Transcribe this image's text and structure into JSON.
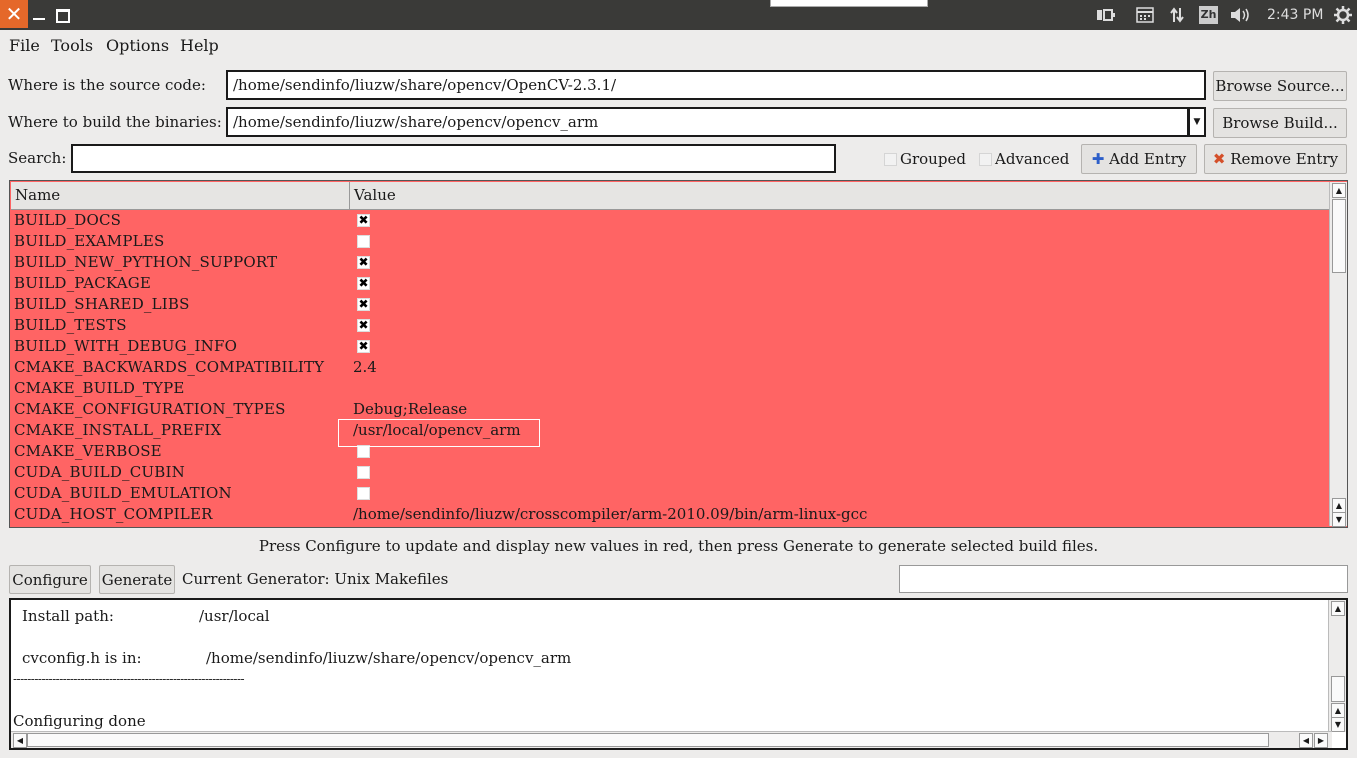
{
  "taskbar": {
    "close_glyph": "✕",
    "time": "2:43 PM",
    "ime": "Zh"
  },
  "menu": [
    "File",
    "Tools",
    "Options",
    "Help"
  ],
  "source": {
    "label": "Where is the source code:",
    "value": "/home/sendinfo/liuzw/share/opencv/OpenCV-2.3.1/",
    "button": "Browse Source..."
  },
  "build": {
    "label": "Where to build the binaries:",
    "value": "/home/sendinfo/liuzw/share/opencv/opencv_arm",
    "button": "Browse Build..."
  },
  "search": {
    "label": "Search:",
    "value": ""
  },
  "options": {
    "grouped": "Grouped",
    "advanced": "Advanced",
    "add_entry": "Add Entry",
    "remove_entry": "Remove Entry"
  },
  "table": {
    "headers": [
      "Name",
      "Value"
    ],
    "rows": [
      {
        "name": "BUILD_DOCS",
        "type": "bool",
        "checked": true
      },
      {
        "name": "BUILD_EXAMPLES",
        "type": "bool",
        "checked": false
      },
      {
        "name": "BUILD_NEW_PYTHON_SUPPORT",
        "type": "bool",
        "checked": true
      },
      {
        "name": "BUILD_PACKAGE",
        "type": "bool",
        "checked": true
      },
      {
        "name": "BUILD_SHARED_LIBS",
        "type": "bool",
        "checked": true
      },
      {
        "name": "BUILD_TESTS",
        "type": "bool",
        "checked": true
      },
      {
        "name": "BUILD_WITH_DEBUG_INFO",
        "type": "bool",
        "checked": true
      },
      {
        "name": "CMAKE_BACKWARDS_COMPATIBILITY",
        "type": "text",
        "value": "2.4"
      },
      {
        "name": "CMAKE_BUILD_TYPE",
        "type": "text",
        "value": ""
      },
      {
        "name": "CMAKE_CONFIGURATION_TYPES",
        "type": "text",
        "value": "Debug;Release"
      },
      {
        "name": "CMAKE_INSTALL_PREFIX",
        "type": "text",
        "value": "/usr/local/opencv_arm"
      },
      {
        "name": "CMAKE_VERBOSE",
        "type": "bool",
        "checked": false
      },
      {
        "name": "CUDA_BUILD_CUBIN",
        "type": "bool",
        "checked": false
      },
      {
        "name": "CUDA_BUILD_EMULATION",
        "type": "bool",
        "checked": false
      },
      {
        "name": "CUDA_HOST_COMPILER",
        "type": "text",
        "value": "/home/sendinfo/liuzw/crosscompiler/arm-2010.09/bin/arm-linux-gcc"
      }
    ]
  },
  "info_text": "Press Configure to update and display new values in red, then press Generate to generate selected build files.",
  "actions": {
    "configure": "Configure",
    "generate": "Generate",
    "generator": "Current Generator: Unix Makefiles"
  },
  "output": {
    "install_label": "Install path:",
    "install_value": "/usr/local",
    "cvconfig_label": "cvconfig.h is in:",
    "cvconfig_value": "/home/sendinfo/liuzw/share/opencv/opencv_arm",
    "separator": "-----------------------------------------------------------------",
    "done": "Configuring done"
  },
  "colors": {
    "changed_row": "#ff6464",
    "window_bg": "#edeceb",
    "close_button": "#e5682a",
    "taskbar": "#3a3a38"
  }
}
